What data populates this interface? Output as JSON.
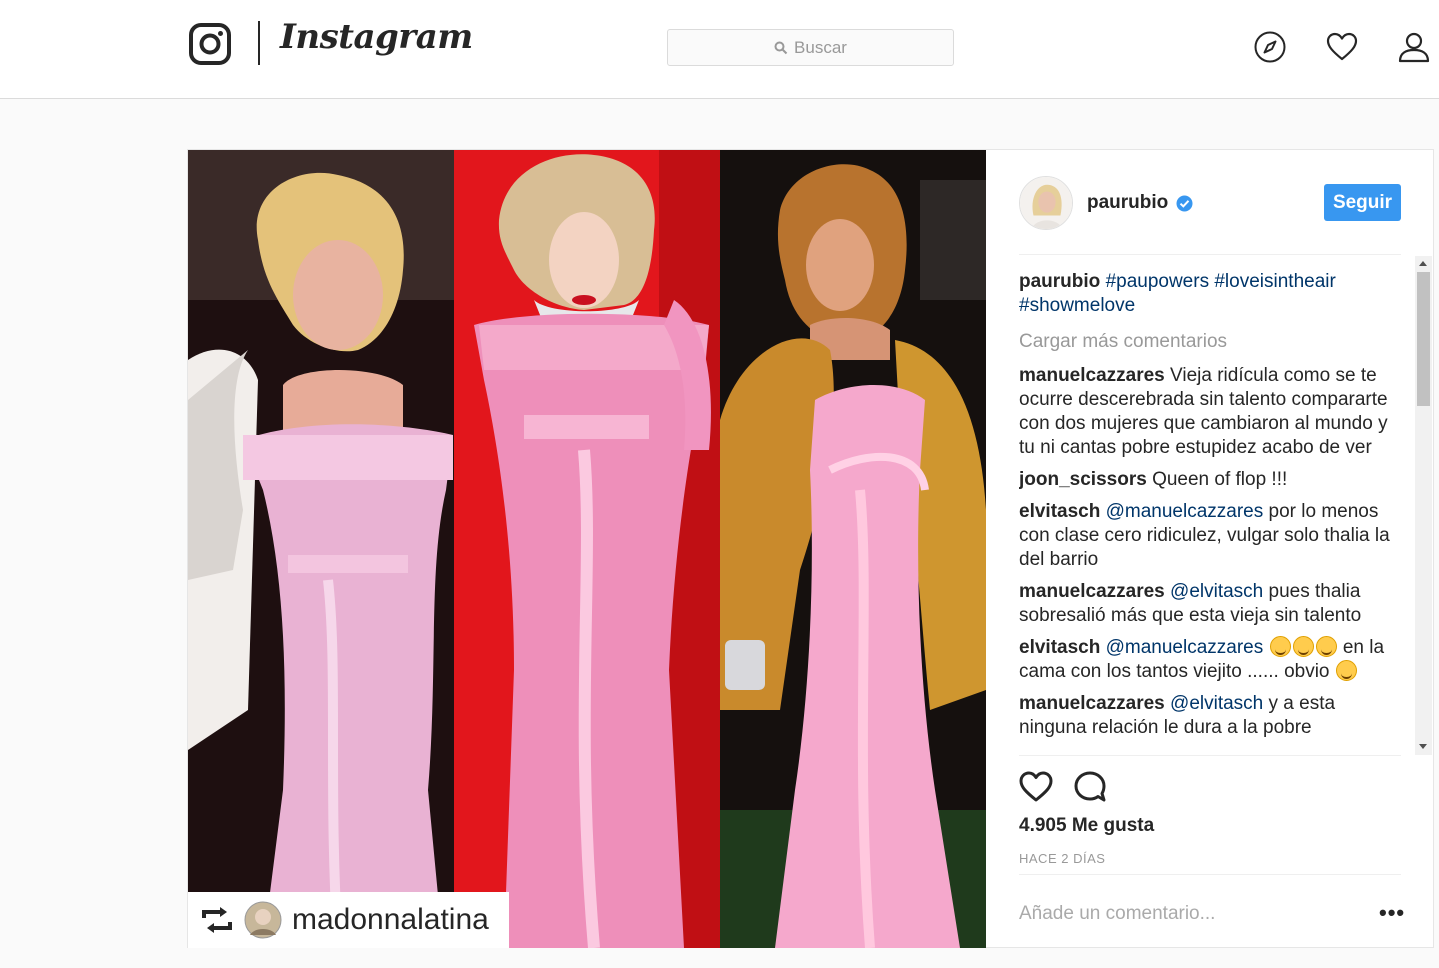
{
  "nav": {
    "wordmark": "Instagram",
    "search_placeholder": "Buscar",
    "icons": [
      "instagram-camera-icon",
      "search-icon",
      "compass-icon",
      "heart-icon",
      "user-icon"
    ]
  },
  "post": {
    "author": "paurubio",
    "verified": true,
    "follow_label": "Seguir",
    "repost": {
      "username": "madonnalatina",
      "icon": "repost-icon"
    },
    "caption": {
      "user": "paurubio",
      "hashtags_line1": "#paupowers #loveisintheair",
      "hashtags_line2": "#showmelove"
    },
    "load_more": "Cargar más comentarios",
    "comments": [
      {
        "user": "manuelcazzares",
        "text": "Vieja ridícula como se te ocurre descerebrada sin talento compararte con dos mujeres que cambiaron al mundo y tu ni cantas pobre estupidez acabo de ver"
      },
      {
        "user": "joon_scissors",
        "text": "Queen of flop !!!"
      },
      {
        "user": "elvitasch",
        "mention": "@manuelcazzares",
        "text": "por lo menos con clase cero ridiculez, vulgar solo thalia la del barrio"
      },
      {
        "user": "manuelcazzares",
        "mention": "@elvitasch",
        "text": "pues thalia sobresalió más que esta vieja sin talento"
      },
      {
        "user": "elvitasch",
        "mention": "@manuelcazzares",
        "text_a": "en la cama con los tantos viejito ...... obvio"
      },
      {
        "user": "manuelcazzares",
        "mention": "@elvitasch",
        "text": "y a esta ninguna relación le dura a la pobre"
      }
    ],
    "likes": "4.905 Me gusta",
    "timestamp": "HACE 2 DÍAS",
    "add_comment_placeholder": "Añade un comentario...",
    "more_label": "•••"
  },
  "colors": {
    "accent": "#3897f0",
    "hashtag": "#003569",
    "muted": "#999999",
    "border": "#dbdbdb"
  }
}
